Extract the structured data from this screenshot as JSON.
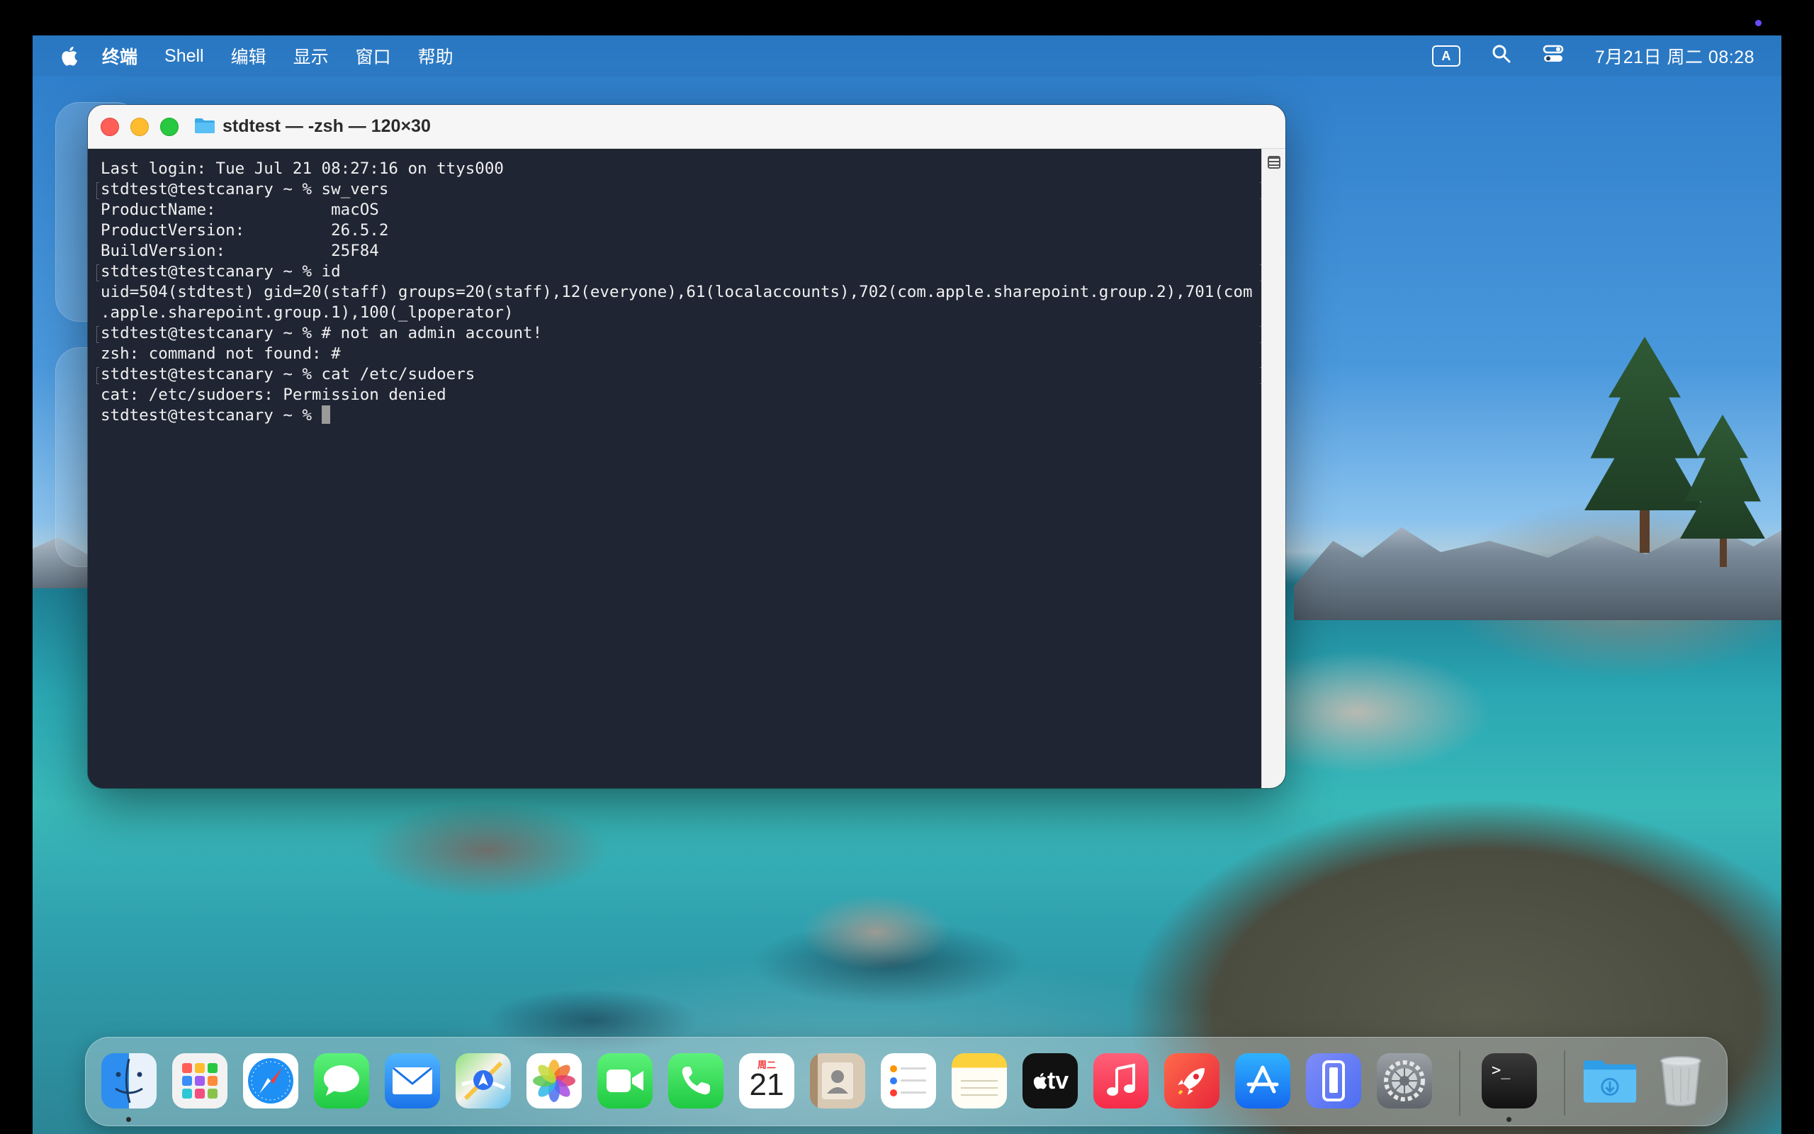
{
  "menubar": {
    "app_name": "终端",
    "items": [
      "Shell",
      "编辑",
      "显示",
      "窗口",
      "帮助"
    ],
    "input_indicator": "A",
    "clock": "7月21日 周二 08:28"
  },
  "terminal": {
    "title": "stdtest — -zsh — 120×30",
    "lines": [
      "Last login: Tue Jul 21 08:27:16 on ttys000",
      "stdtest@testcanary ~ % sw_vers",
      "ProductName:\t\tmacOS",
      "ProductVersion:\t\t26.5.2",
      "BuildVersion:\t\t25F84",
      "stdtest@testcanary ~ % id",
      "uid=504(stdtest) gid=20(staff) groups=20(staff),12(everyone),61(localaccounts),702(com.apple.sharepoint.group.2),701(com",
      ".apple.sharepoint.group.1),100(_lpoperator)",
      "stdtest@testcanary ~ % # not an admin account!",
      "zsh: command not found: #",
      "stdtest@testcanary ~ % cat /etc/sudoers",
      "cat: /etc/sudoers: Permission denied"
    ],
    "current_prompt": "stdtest@testcanary ~ % "
  },
  "dock": {
    "calendar_weekday": "周二",
    "calendar_date": "21",
    "tv_label": "tv",
    "terminal_glyph": ">_",
    "apps": [
      "finder-icon",
      "launchpad-icon",
      "safari-icon",
      "messages-icon",
      "mail-icon",
      "maps-icon",
      "photos-icon",
      "facetime-icon",
      "phone-icon",
      "calendar-icon",
      "contacts-icon",
      "reminders-icon",
      "notes-icon",
      "tv-icon",
      "music-icon",
      "rocket-icon",
      "app-store-icon",
      "iphone-mirroring-icon",
      "system-settings-icon",
      "terminal-icon",
      "downloads-icon",
      "trash-icon"
    ]
  }
}
